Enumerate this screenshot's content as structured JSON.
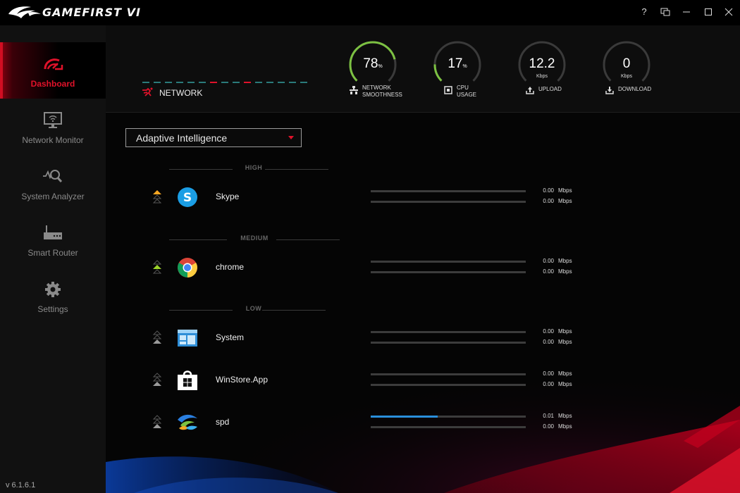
{
  "app": {
    "title": "GAMEFIRST VI",
    "version": "v 6.1.6.1"
  },
  "window_controls": [
    {
      "name": "help-button",
      "glyph": "?"
    },
    {
      "name": "minimize-to-tray-button",
      "glyph": "⧉"
    },
    {
      "name": "minimize-button",
      "glyph": "—"
    },
    {
      "name": "maximize-button",
      "glyph": "☐"
    },
    {
      "name": "close-button",
      "glyph": "✕"
    }
  ],
  "sidebar": {
    "items": [
      {
        "label": "Dashboard",
        "icon": "dashboard-speedometer-icon",
        "active": true
      },
      {
        "label": "Network Monitor",
        "icon": "monitor-wifi-icon",
        "active": false
      },
      {
        "label": "System Analyzer",
        "icon": "analyzer-magnifier-icon",
        "active": false
      },
      {
        "label": "Smart Router",
        "icon": "router-icon",
        "active": false
      },
      {
        "label": "Settings",
        "icon": "gear-icon",
        "active": false
      }
    ]
  },
  "colors": {
    "accent": "#e0122a",
    "gauge_green": "#7cc142",
    "bar_blue": "#2a8fdb",
    "prio_high": "#f5a623",
    "prio_medium": "#9bd22a",
    "prio_low": "#9a9a9a"
  },
  "header": {
    "network_label": "NETWORK",
    "gauges": [
      {
        "value": "78",
        "suffix": "%",
        "unit": "",
        "label": "NETWORK\nSMOOTHNESS",
        "label_line1": "NETWORK",
        "label_line2": "SMOOTHNESS",
        "icon": "network-smoothness-icon",
        "fraction": 0.78
      },
      {
        "value": "17",
        "suffix": "%",
        "unit": "",
        "label_line1": "CPU",
        "label_line2": "USAGE",
        "icon": "cpu-icon",
        "fraction": 0.17
      },
      {
        "value": "12.2",
        "suffix": "",
        "unit": "Kbps",
        "label_line1": "UPLOAD",
        "label_line2": "",
        "icon": "upload-icon",
        "fraction": 0.0
      },
      {
        "value": "0",
        "suffix": "",
        "unit": "Kbps",
        "label_line1": "DOWNLOAD",
        "label_line2": "",
        "icon": "download-icon",
        "fraction": 0.0
      }
    ]
  },
  "mode_dropdown": {
    "selected": "Adaptive Intelligence"
  },
  "sections": [
    {
      "title": "HIGH"
    },
    {
      "title": "MEDIUM"
    },
    {
      "title": "LOW"
    }
  ],
  "apps": [
    {
      "name": "Skype",
      "priority": "high",
      "icon": "skype-icon",
      "upload": "0.00",
      "download": "0.00",
      "unit": "Mbps",
      "upload_fraction": 0.0,
      "download_fraction": 0.0
    },
    {
      "name": "chrome",
      "priority": "medium",
      "icon": "chrome-icon",
      "upload": "0.00",
      "download": "0.00",
      "unit": "Mbps",
      "upload_fraction": 0.0,
      "download_fraction": 0.0
    },
    {
      "name": "System",
      "priority": "low",
      "icon": "system-window-icon",
      "upload": "0.00",
      "download": "0.00",
      "unit": "Mbps",
      "upload_fraction": 0.0,
      "download_fraction": 0.0
    },
    {
      "name": "WinStore.App",
      "priority": "low",
      "icon": "windows-store-icon",
      "upload": "0.00",
      "download": "0.00",
      "unit": "Mbps",
      "upload_fraction": 0.0,
      "download_fraction": 0.0
    },
    {
      "name": "spd",
      "priority": "low",
      "icon": "spd-app-icon",
      "upload": "0.01",
      "download": "0.00",
      "unit": "Mbps",
      "upload_fraction": 0.43,
      "download_fraction": 0.0
    }
  ]
}
